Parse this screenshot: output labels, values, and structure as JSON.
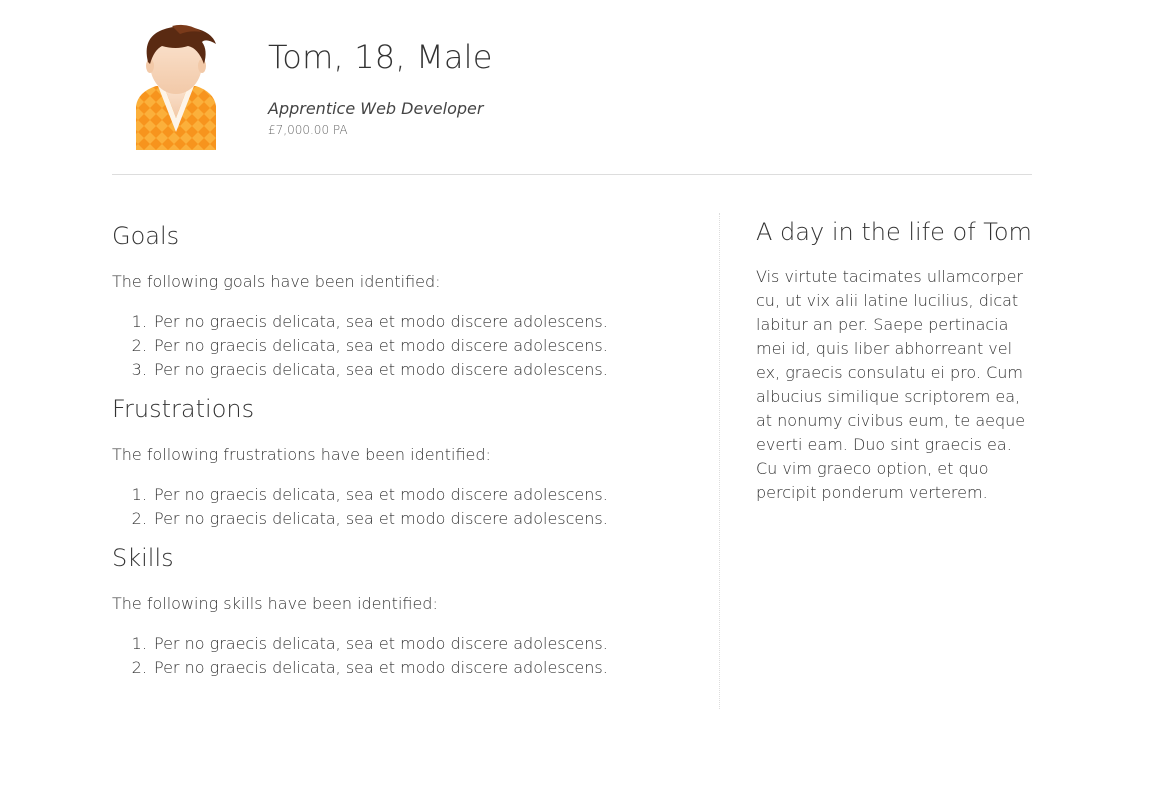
{
  "profile": {
    "name_line": "Tom, 18, Male",
    "job_title": "Apprentice Web Developer",
    "salary": "£7,000.00 PA",
    "avatar_icon": "person-avatar-icon",
    "colors": {
      "sweater": "#f7941d",
      "hair": "#5a2a12"
    }
  },
  "sections": {
    "goals": {
      "heading": "Goals",
      "intro": "The following goals have been identified:",
      "items": [
        "Per no graecis delicata, sea et modo discere adolescens.",
        "Per no graecis delicata, sea et modo discere adolescens.",
        "Per no graecis delicata, sea et modo discere adolescens."
      ]
    },
    "frustrations": {
      "heading": "Frustrations",
      "intro": "The following frustrations have been identified:",
      "items": [
        "Per no graecis delicata, sea et modo discere adolescens.",
        "Per no graecis delicata, sea et modo discere adolescens."
      ]
    },
    "skills": {
      "heading": "Skills",
      "intro": "The following skills have been identified:",
      "items": [
        "Per no graecis delicata, sea et modo discere adolescens.",
        "Per no graecis delicata, sea et modo discere adolescens."
      ]
    }
  },
  "day_in_life": {
    "heading": "A day in the life of Tom",
    "text": "Vis virtute tacimates ullamcorper cu, ut vix alii latine lucilius, dicat labitur an per. Saepe pertinacia mei id, quis liber abhorreant vel ex, graecis consulatu ei pro. Cum albucius similique scriptorem ea, at nonumy civibus eum, te aeque everti eam. Duo sint graecis ea. Cu vim graeco option, et quo percipit ponderum verterem."
  }
}
